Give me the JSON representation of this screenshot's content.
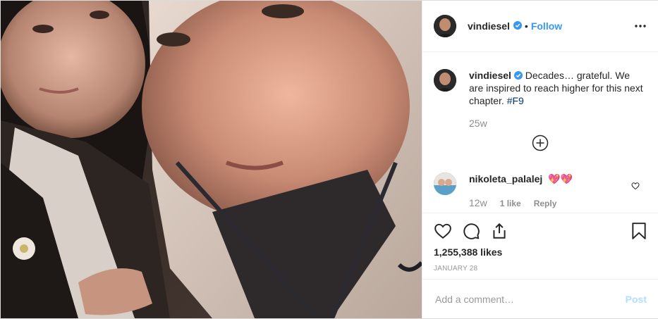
{
  "post": {
    "username": "vindiesel",
    "follow_label": "Follow",
    "dot": "•",
    "caption": {
      "username": "vindiesel",
      "text": "Decades… grateful. We are inspired to reach higher for this next chapter. ",
      "hashtag": "#F9",
      "age": "25w"
    },
    "reply": {
      "username": "nikoleta_palalej",
      "text": "💖💖",
      "age": "12w",
      "likes": "1 like",
      "reply_label": "Reply"
    },
    "likes": "1,255,388 likes",
    "date": "January 28",
    "comment_placeholder": "Add a comment…",
    "post_label": "Post"
  },
  "colors": {
    "accent": "#3897f0",
    "hashtag": "#003569",
    "muted": "#8e8e8e",
    "post_disabled": "#b2dffc"
  },
  "icons": [
    "verified-icon",
    "more-options-icon",
    "load-more-icon",
    "heart-icon",
    "comment-icon",
    "share-icon",
    "bookmark-icon"
  ]
}
